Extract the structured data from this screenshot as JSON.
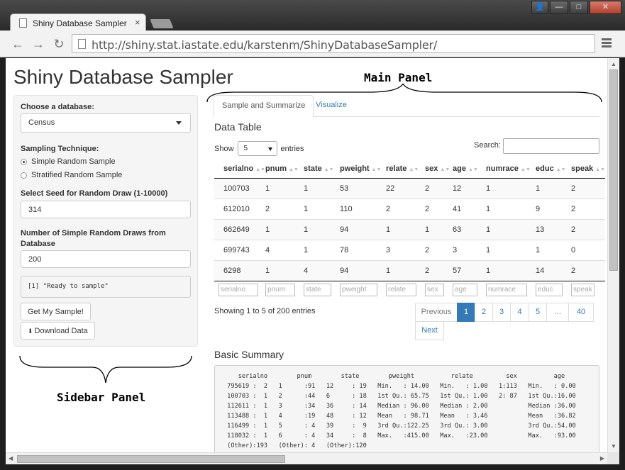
{
  "browser": {
    "tab_title": "Shiny Database Sampler",
    "url": "http://shiny.stat.iastate.edu/karstenm/ShinyDatabaseSampler/"
  },
  "page": {
    "title": "Shiny Database Sampler"
  },
  "annotations": {
    "main_panel": "Main Panel",
    "sidebar_panel": "Sidebar Panel"
  },
  "sidebar": {
    "database_label": "Choose a database:",
    "database_value": "Census",
    "technique_label": "Sampling Technique:",
    "technique_options": [
      "Simple Random Sample",
      "Stratified Random Sample"
    ],
    "technique_selected": "Simple Random Sample",
    "seed_label": "Select Seed for Random Draw (1-10000)",
    "seed_value": "314",
    "draws_label": "Number of Simple Random Draws from Database",
    "draws_value": "200",
    "status_output": "[1] \"Ready to sample\"",
    "get_sample_button": "Get My Sample!",
    "download_button": "Download Data"
  },
  "main": {
    "tabs": [
      {
        "label": "Sample and Summarize",
        "active": true
      },
      {
        "label": "Visualize",
        "active": false
      }
    ],
    "data_table_heading": "Data Table",
    "show_label": "Show",
    "show_value": "5",
    "entries_label": "entries",
    "search_label": "Search:",
    "columns": [
      "serialno",
      "pnum",
      "state",
      "pweight",
      "relate",
      "sex",
      "age",
      "numrace",
      "educ",
      "speak"
    ],
    "rows": [
      [
        "100703",
        "1",
        "1",
        "53",
        "22",
        "2",
        "12",
        "1",
        "1",
        "2"
      ],
      [
        "612010",
        "2",
        "1",
        "110",
        "2",
        "2",
        "41",
        "1",
        "9",
        "2"
      ],
      [
        "662649",
        "1",
        "1",
        "94",
        "1",
        "1",
        "63",
        "1",
        "13",
        "2"
      ],
      [
        "699743",
        "4",
        "1",
        "78",
        "3",
        "2",
        "3",
        "1",
        "1",
        "0"
      ],
      [
        "6298",
        "1",
        "4",
        "94",
        "1",
        "2",
        "57",
        "1",
        "14",
        "2"
      ]
    ],
    "info": "Showing 1 to 5 of 200 entries",
    "pagination": {
      "previous": "Previous",
      "pages": [
        "1",
        "2",
        "3",
        "4",
        "5",
        "…",
        "40"
      ],
      "active_page": "1",
      "next": "Next"
    },
    "summary_heading": "Basic Summary",
    "summary_text": "    serialno        pnum        state        pweight          relate         sex          age       \n 795619 :  2   1      :91   12     : 19   Min.   : 14.00   Min.   : 1.00   1:113   Min.   : 0.00  \n 100703 :  1   2      :44   6      : 18   1st Qu.: 65.75   1st Qu.: 1.00   2: 87   1st Qu.:16.00  \n 112611 :  1   3      :34   36     : 14   Median : 96.00   Median : 2.00           Median :36.00  \n 113488 :  1   4      :19   48     : 12   Mean   : 98.71   Mean   : 3.46           Mean   :36.82  \n 116499 :  1   5      : 4   39     :  9   3rd Qu.:122.25   3rd Qu.: 3.00           3rd Qu.:54.00  \n 118032 :  1   6      : 4   34     :  8   Max.   :415.00   Max.   :23.00           Max.   :93.00  \n (Other):193   (Other): 4   (Other):120                                                         "
  }
}
